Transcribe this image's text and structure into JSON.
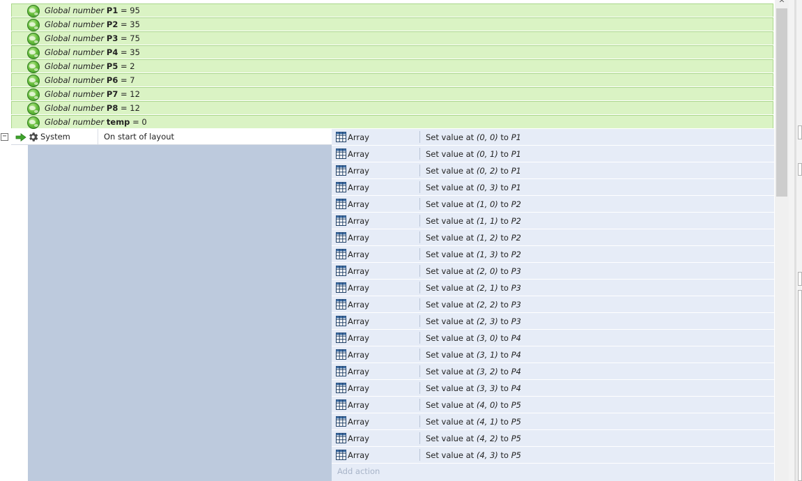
{
  "globals": [
    {
      "type": "Global number",
      "name": "P1",
      "value": "= 95"
    },
    {
      "type": "Global number",
      "name": "P2",
      "value": "= 35"
    },
    {
      "type": "Global number",
      "name": "P3",
      "value": "= 75"
    },
    {
      "type": "Global number",
      "name": "P4",
      "value": "= 35"
    },
    {
      "type": "Global number",
      "name": "P5",
      "value": "= 2"
    },
    {
      "type": "Global number",
      "name": "P6",
      "value": "= 7"
    },
    {
      "type": "Global number",
      "name": "P7",
      "value": "= 12"
    },
    {
      "type": "Global number",
      "name": "P8",
      "value": "= 12"
    },
    {
      "type": "Global number",
      "name": "temp",
      "value": "= 0"
    }
  ],
  "event": {
    "toggle": "−",
    "condition_object": "System",
    "condition_text": "On start of layout",
    "action_object": "Array",
    "action_prefix": "Set value at",
    "actions": [
      {
        "coord": "(0, 0)",
        "target": "P1"
      },
      {
        "coord": "(0, 1)",
        "target": "P1"
      },
      {
        "coord": "(0, 2)",
        "target": "P1"
      },
      {
        "coord": "(0, 3)",
        "target": "P1"
      },
      {
        "coord": "(1, 0)",
        "target": "P2"
      },
      {
        "coord": "(1, 1)",
        "target": "P2"
      },
      {
        "coord": "(1, 2)",
        "target": "P2"
      },
      {
        "coord": "(1, 3)",
        "target": "P2"
      },
      {
        "coord": "(2, 0)",
        "target": "P3"
      },
      {
        "coord": "(2, 1)",
        "target": "P3"
      },
      {
        "coord": "(2, 2)",
        "target": "P3"
      },
      {
        "coord": "(2, 3)",
        "target": "P3"
      },
      {
        "coord": "(3, 0)",
        "target": "P4"
      },
      {
        "coord": "(3, 1)",
        "target": "P4"
      },
      {
        "coord": "(3, 2)",
        "target": "P4"
      },
      {
        "coord": "(3, 3)",
        "target": "P4"
      },
      {
        "coord": "(4, 0)",
        "target": "P5"
      },
      {
        "coord": "(4, 1)",
        "target": "P5"
      },
      {
        "coord": "(4, 2)",
        "target": "P5"
      },
      {
        "coord": "(4, 3)",
        "target": "P5"
      }
    ],
    "add_action": "Add action"
  },
  "scrollbar": {
    "up_glyph": "^"
  },
  "colors": {
    "global_row_bg": "#daf3c4",
    "action_bg": "#e6ecf7",
    "event_filler": "#bdcadd",
    "add_action_text": "#a8b4c8"
  }
}
